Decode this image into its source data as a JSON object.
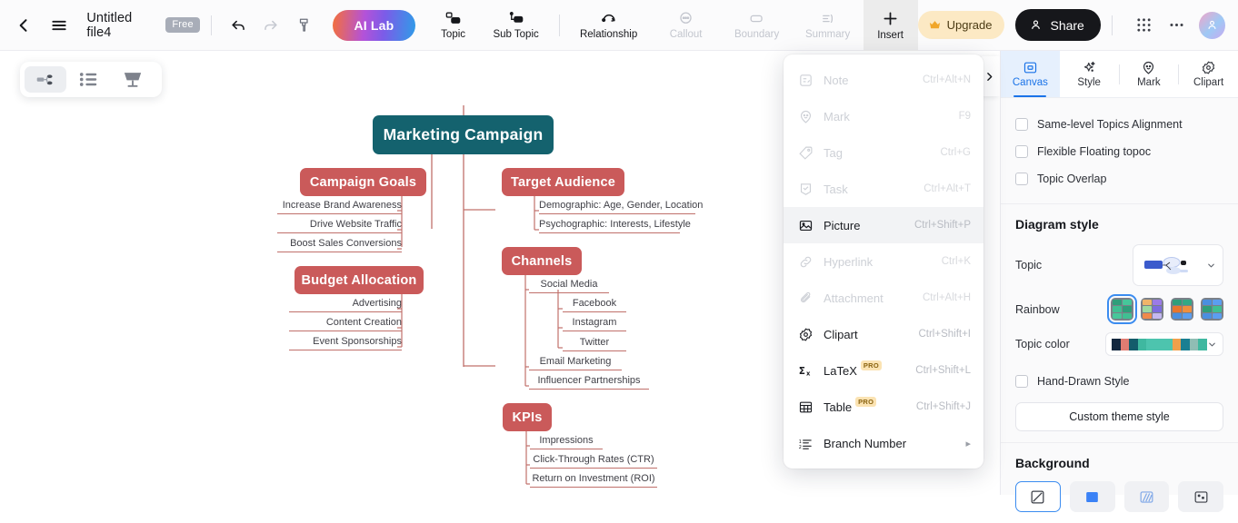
{
  "topbar": {
    "back_icon": "chevron-left-icon",
    "menu_icon": "hamburger-icon",
    "file_name": "Untitled file4",
    "plan_badge": "Free",
    "undo_icon": "undo-icon",
    "redo_icon": "redo-icon",
    "format_painter_icon": "format-painter-icon",
    "ai_lab_label": "AI Lab",
    "upgrade_label": "Upgrade",
    "upgrade_icon": "crown-icon",
    "share_label": "Share",
    "share_icon": "person-icon",
    "apps_icon": "grid-apps-icon",
    "more_icon": "more-horizontal-icon",
    "avatar_icon": "user-avatar",
    "tools": [
      {
        "label": "Topic",
        "icon": "topic-icon",
        "state": "enabled"
      },
      {
        "label": "Sub Topic",
        "icon": "sub-topic-icon",
        "state": "enabled"
      },
      {
        "label": "Relationship",
        "icon": "relationship-icon",
        "state": "enabled"
      },
      {
        "label": "Callout",
        "icon": "callout-icon",
        "state": "disabled"
      },
      {
        "label": "Boundary",
        "icon": "boundary-icon",
        "state": "disabled"
      },
      {
        "label": "Summary",
        "icon": "summary-icon",
        "state": "disabled"
      },
      {
        "label": "Insert",
        "icon": "plus-icon",
        "state": "active"
      }
    ]
  },
  "canvas": {
    "view_modes": [
      {
        "name": "mindmap-view",
        "icon": "mindmap-icon",
        "selected": true
      },
      {
        "name": "outline-view",
        "icon": "outline-list-icon",
        "selected": false
      },
      {
        "name": "presentation-view",
        "icon": "presentation-icon",
        "selected": false
      }
    ],
    "collapse_icon": "chevron-right-icon",
    "root_color": "#14626e",
    "branch_color": "#ca5a5a",
    "line_color": "#c0706b"
  },
  "mindmap": {
    "root": "Marketing Campaign",
    "branches": [
      {
        "title": "Campaign Goals",
        "children": [
          "Increase Brand Awareness",
          "Drive Website Traffic",
          "Boost Sales Conversions"
        ]
      },
      {
        "title": "Budget Allocation",
        "children": [
          "Advertising",
          "Content Creation",
          "Event Sponsorships"
        ]
      },
      {
        "title": "Target Audience",
        "children": [
          "Demographic: Age, Gender, Location",
          "Psychographic: Interests, Lifestyle"
        ]
      },
      {
        "title": "Channels",
        "children": [
          "Social Media",
          "Facebook",
          "Instagram",
          "Twitter",
          "Email Marketing",
          "Influencer Partnerships"
        ]
      },
      {
        "title": "KPIs",
        "children": [
          "Impressions",
          "Click-Through Rates (CTR)",
          "Return on Investment (ROI)"
        ]
      }
    ]
  },
  "insert_menu": {
    "items": [
      {
        "label": "Note",
        "shortcut": "Ctrl+Alt+N",
        "icon": "note-icon",
        "state": "disabled"
      },
      {
        "label": "Mark",
        "shortcut": "F9",
        "icon": "mark-smiley-icon",
        "state": "disabled"
      },
      {
        "label": "Tag",
        "shortcut": "Ctrl+G",
        "icon": "tag-icon",
        "state": "disabled"
      },
      {
        "label": "Task",
        "shortcut": "Ctrl+Alt+T",
        "icon": "task-icon",
        "state": "disabled"
      },
      {
        "label": "Picture",
        "shortcut": "Ctrl+Shift+P",
        "icon": "picture-icon",
        "state": "highlighted"
      },
      {
        "label": "Hyperlink",
        "shortcut": "Ctrl+K",
        "icon": "link-icon",
        "state": "disabled"
      },
      {
        "label": "Attachment",
        "shortcut": "Ctrl+Alt+H",
        "icon": "paperclip-icon",
        "state": "disabled"
      },
      {
        "label": "Clipart",
        "shortcut": "Ctrl+Shift+I",
        "icon": "clipart-icon",
        "state": "enabled"
      },
      {
        "label": "LaTeX",
        "shortcut": "Ctrl+Shift+L",
        "icon": "latex-sigma-icon",
        "state": "enabled",
        "badge": "PRO"
      },
      {
        "label": "Table",
        "shortcut": "Ctrl+Shift+J",
        "icon": "table-icon",
        "state": "enabled",
        "badge": "PRO"
      },
      {
        "label": "Branch Number",
        "shortcut": "",
        "icon": "branch-number-icon",
        "state": "enabled",
        "submenu": true
      }
    ]
  },
  "panel": {
    "tabs": [
      {
        "label": "Canvas",
        "icon": "canvas-icon",
        "selected": true
      },
      {
        "label": "Style",
        "icon": "sparkle-icon",
        "selected": false
      },
      {
        "label": "Mark",
        "icon": "mark-smiley-icon",
        "selected": false
      },
      {
        "label": "Clipart",
        "icon": "clipart-icon",
        "selected": false
      }
    ],
    "checkboxes": [
      {
        "label": "Same-level Topics Alignment",
        "checked": false
      },
      {
        "label": "Flexible Floating topoc",
        "checked": false
      },
      {
        "label": "Topic Overlap",
        "checked": false
      }
    ],
    "diagram_style": {
      "title": "Diagram style",
      "topic_label": "Topic",
      "topic_preview_icon": "topic-layout-preview",
      "rainbow_label": "Rainbow",
      "rainbow_options": [
        {
          "selected": true,
          "colors": [
            "#2f9e7a",
            "#3fbf92",
            "#34a884",
            "#46c79a",
            "#2f9e7a",
            "#3fbf92"
          ]
        },
        {
          "selected": false,
          "colors": [
            "#f0a860",
            "#b07ee8",
            "#9fd8a0",
            "#7c6ce0",
            "#f08a4b",
            "#c4b8f0"
          ]
        },
        {
          "selected": false,
          "colors": [
            "#2f9e7a",
            "#34a884",
            "#e8762c",
            "#ef8f3e",
            "#4a8fe0",
            "#5b9ef0"
          ]
        },
        {
          "selected": false,
          "colors": [
            "#4a8fe0",
            "#5b9ef0",
            "#2f9e7a",
            "#3fbf92",
            "#4a8fe0",
            "#5b9ef0"
          ]
        }
      ],
      "topic_color_label": "Topic color",
      "topic_color_swatches": [
        "#13283f",
        "#e07c72",
        "#145c6b",
        "#3fb8a0",
        "#4dc4ae",
        "#4dc4ae",
        "#f0a04b",
        "#1a7f92",
        "#8fbdb4",
        "#3fb8a0"
      ],
      "hand_drawn_label": "Hand-Drawn Style",
      "hand_drawn_checked": false,
      "custom_theme_label": "Custom theme style"
    },
    "background": {
      "title": "Background",
      "options": [
        {
          "icon": "bg-none-icon",
          "selected": true
        },
        {
          "icon": "bg-color-icon",
          "selected": false
        },
        {
          "icon": "bg-pattern-icon",
          "selected": false
        },
        {
          "icon": "bg-image-icon",
          "selected": false
        }
      ]
    }
  }
}
